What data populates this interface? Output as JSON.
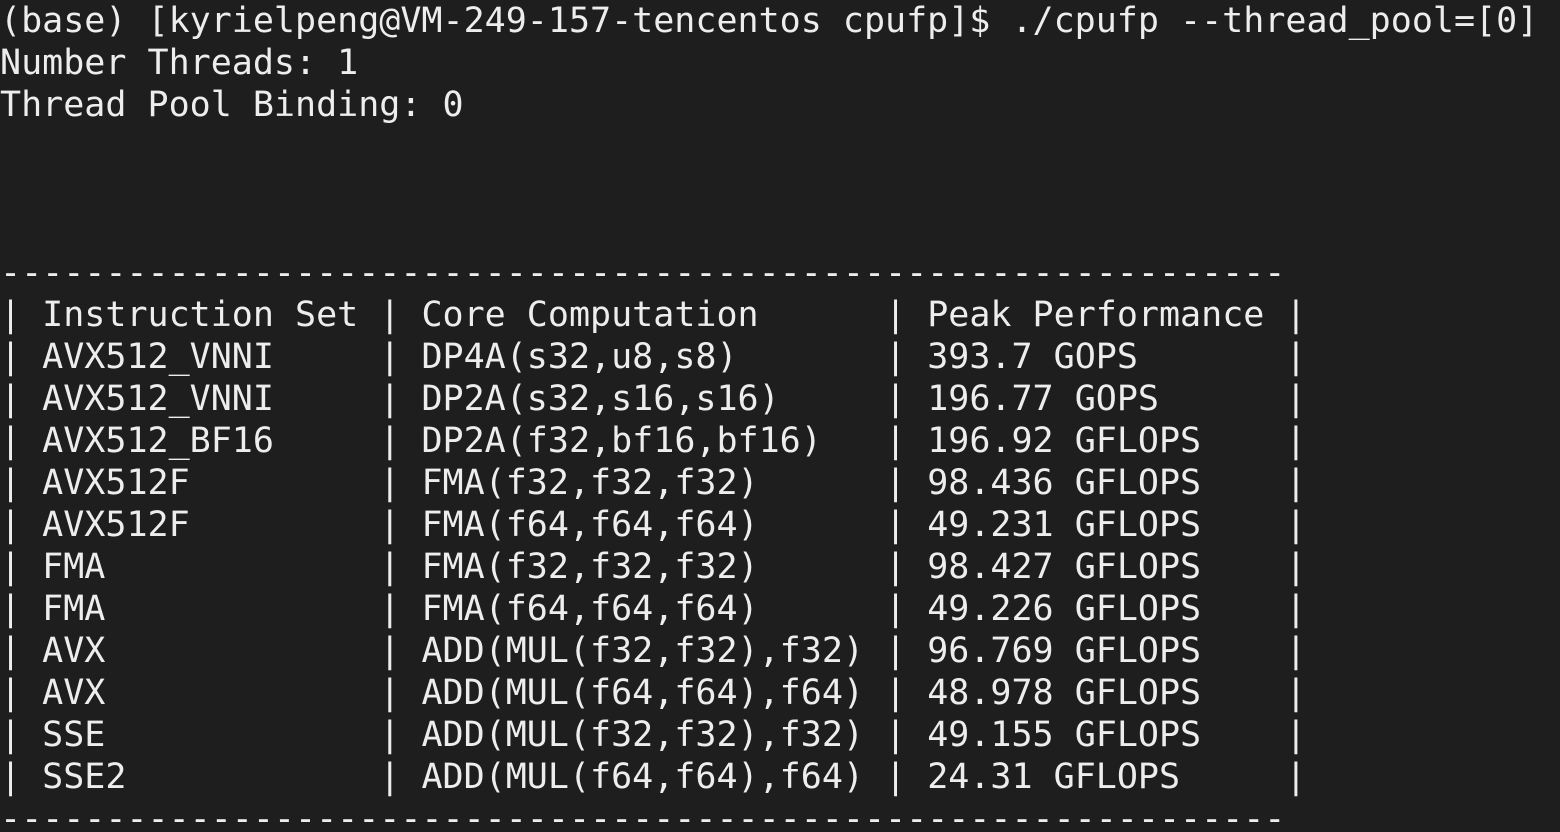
{
  "terminal": {
    "prompt": "(base) [kyrielpeng@VM-249-157-tencentos cpufp]$ ",
    "command": "./cpufp --thread_pool=[0]",
    "output_lines": [
      "Number Threads: 1",
      "Thread Pool Binding: 0"
    ]
  },
  "table": {
    "separator": "-------------------------------------------------------------",
    "headers": [
      "Instruction Set",
      "Core Computation",
      "Peak Performance"
    ],
    "rows": [
      [
        "AVX512_VNNI",
        "DP4A(s32,u8,s8)",
        "393.7 GOPS"
      ],
      [
        "AVX512_VNNI",
        "DP2A(s32,s16,s16)",
        "196.77 GOPS"
      ],
      [
        "AVX512_BF16",
        "DP2A(f32,bf16,bf16)",
        "196.92 GFLOPS"
      ],
      [
        "AVX512F",
        "FMA(f32,f32,f32)",
        "98.436 GFLOPS"
      ],
      [
        "AVX512F",
        "FMA(f64,f64,f64)",
        "49.231 GFLOPS"
      ],
      [
        "FMA",
        "FMA(f32,f32,f32)",
        "98.427 GFLOPS"
      ],
      [
        "FMA",
        "FMA(f64,f64,f64)",
        "49.226 GFLOPS"
      ],
      [
        "AVX",
        "ADD(MUL(f32,f32),f32)",
        "96.769 GFLOPS"
      ],
      [
        "AVX",
        "ADD(MUL(f64,f64),f64)",
        "48.978 GFLOPS"
      ],
      [
        "SSE",
        "ADD(MUL(f32,f32),f32)",
        "49.155 GFLOPS"
      ],
      [
        "SSE2",
        "ADD(MUL(f64,f64),f64)",
        "24.31 GFLOPS"
      ]
    ]
  }
}
